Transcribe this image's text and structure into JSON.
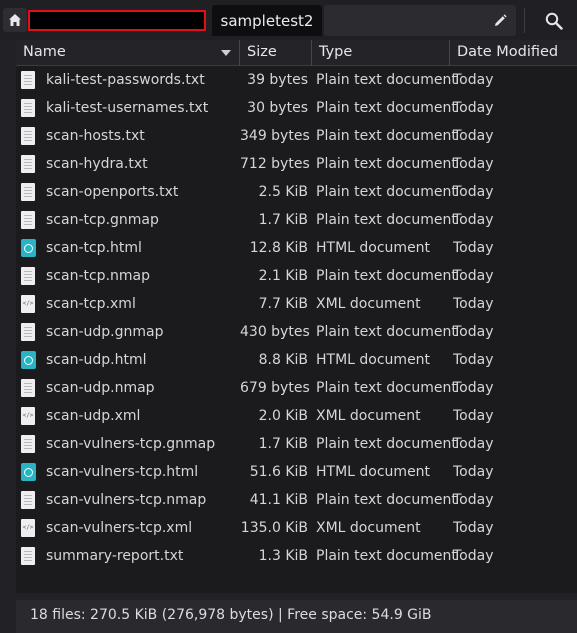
{
  "pathbar": {
    "home_icon": "home-icon",
    "current_folder": "sampletest2",
    "edit_icon": "pencil-icon",
    "search_icon": "search-icon"
  },
  "columns": {
    "name": "Name",
    "size": "Size",
    "type": "Type",
    "date": "Date Modified"
  },
  "files": [
    {
      "name": "kali-test-passwords.txt",
      "size": "39 bytes",
      "type": "Plain text document",
      "date": "Today",
      "icon": "text-file-icon"
    },
    {
      "name": "kali-test-usernames.txt",
      "size": "30 bytes",
      "type": "Plain text document",
      "date": "Today",
      "icon": "text-file-icon"
    },
    {
      "name": "scan-hosts.txt",
      "size": "349 bytes",
      "type": "Plain text document",
      "date": "Today",
      "icon": "text-file-icon"
    },
    {
      "name": "scan-hydra.txt",
      "size": "712 bytes",
      "type": "Plain text document",
      "date": "Today",
      "icon": "text-file-icon"
    },
    {
      "name": "scan-openports.txt",
      "size": "2.5 KiB",
      "type": "Plain text document",
      "date": "Today",
      "icon": "text-file-icon"
    },
    {
      "name": "scan-tcp.gnmap",
      "size": "1.7 KiB",
      "type": "Plain text document",
      "date": "Today",
      "icon": "text-file-icon"
    },
    {
      "name": "scan-tcp.html",
      "size": "12.8 KiB",
      "type": "HTML document",
      "date": "Today",
      "icon": "html-file-icon"
    },
    {
      "name": "scan-tcp.nmap",
      "size": "2.1 KiB",
      "type": "Plain text document",
      "date": "Today",
      "icon": "text-file-icon"
    },
    {
      "name": "scan-tcp.xml",
      "size": "7.7 KiB",
      "type": "XML document",
      "date": "Today",
      "icon": "xml-file-icon"
    },
    {
      "name": "scan-udp.gnmap",
      "size": "430 bytes",
      "type": "Plain text document",
      "date": "Today",
      "icon": "text-file-icon"
    },
    {
      "name": "scan-udp.html",
      "size": "8.8 KiB",
      "type": "HTML document",
      "date": "Today",
      "icon": "html-file-icon"
    },
    {
      "name": "scan-udp.nmap",
      "size": "679 bytes",
      "type": "Plain text document",
      "date": "Today",
      "icon": "text-file-icon"
    },
    {
      "name": "scan-udp.xml",
      "size": "2.0 KiB",
      "type": "XML document",
      "date": "Today",
      "icon": "xml-file-icon"
    },
    {
      "name": "scan-vulners-tcp.gnmap",
      "size": "1.7 KiB",
      "type": "Plain text document",
      "date": "Today",
      "icon": "text-file-icon"
    },
    {
      "name": "scan-vulners-tcp.html",
      "size": "51.6 KiB",
      "type": "HTML document",
      "date": "Today",
      "icon": "html-file-icon"
    },
    {
      "name": "scan-vulners-tcp.nmap",
      "size": "41.1 KiB",
      "type": "Plain text document",
      "date": "Today",
      "icon": "text-file-icon"
    },
    {
      "name": "scan-vulners-tcp.xml",
      "size": "135.0 KiB",
      "type": "XML document",
      "date": "Today",
      "icon": "xml-file-icon"
    },
    {
      "name": "summary-report.txt",
      "size": "1.3 KiB",
      "type": "Plain text document",
      "date": "Today",
      "icon": "text-file-icon"
    }
  ],
  "status": {
    "text": "18 files: 270.5 KiB (276,978 bytes)  |  Free space: 54.9 GiB"
  }
}
